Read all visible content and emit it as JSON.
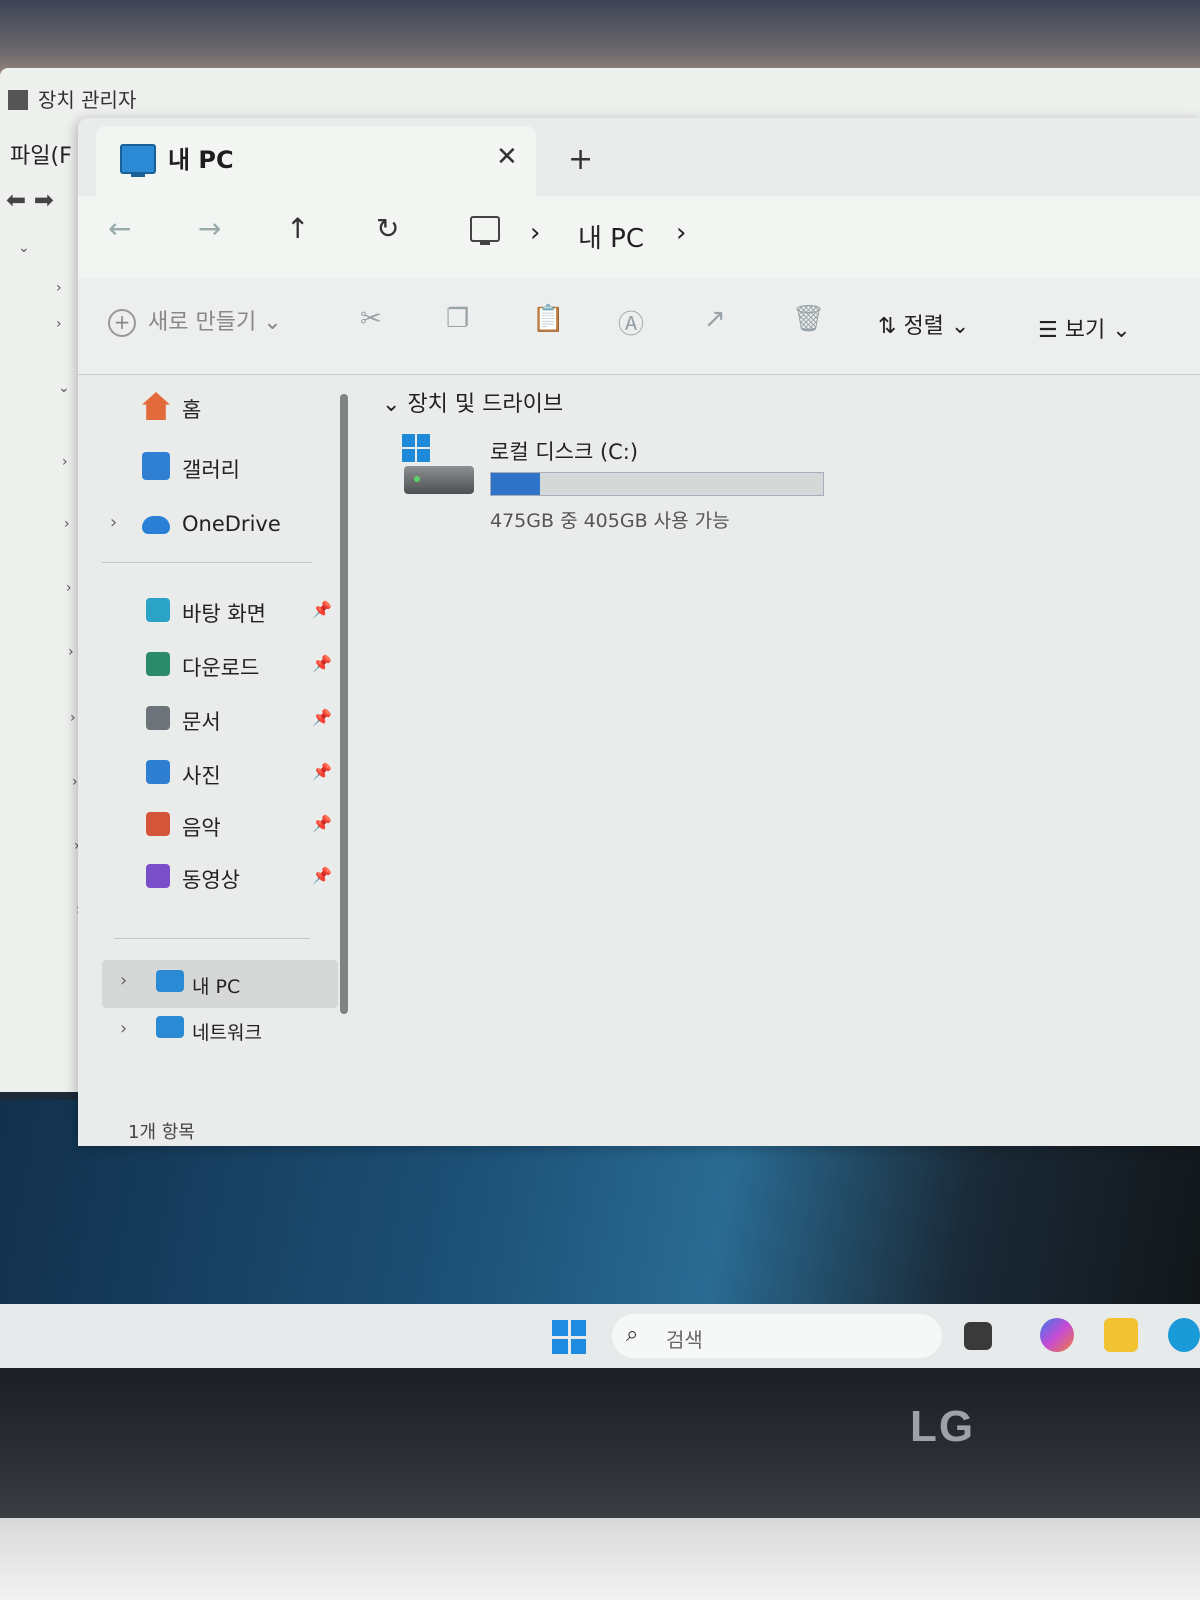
{
  "background_window": {
    "title": "장치 관리자",
    "menu_file": "파일(F"
  },
  "tab": {
    "title": "내 PC",
    "close": "✕",
    "add": "+"
  },
  "nav": {
    "back": "←",
    "forward": "→",
    "up": "↑",
    "refresh": "↻",
    "separator": "›",
    "location": "내 PC"
  },
  "toolbar": {
    "new_label": "새로 만들기",
    "sort_label": "정렬",
    "view_label": "보기",
    "dropdown": "⌄"
  },
  "sidebar": {
    "home": "홈",
    "gallery": "갤러리",
    "onedrive": "OneDrive",
    "quick": [
      {
        "label": "바탕 화면",
        "icon": "desktop-icon",
        "color": "#2aa3c7"
      },
      {
        "label": "다운로드",
        "icon": "download-icon",
        "color": "#2a8a6a"
      },
      {
        "label": "문서",
        "icon": "documents-icon",
        "color": "#6c7379"
      },
      {
        "label": "사진",
        "icon": "pictures-icon",
        "color": "#2e7fd1"
      },
      {
        "label": "음악",
        "icon": "music-icon",
        "color": "#d5553a"
      },
      {
        "label": "동영상",
        "icon": "videos-icon",
        "color": "#7a4ec9"
      }
    ],
    "this_pc": "내 PC",
    "network": "네트워크",
    "pin": "📌",
    "chevron": "›"
  },
  "main": {
    "section_title": "장치 및 드라이브",
    "drive": {
      "name": "로컬 디스크 (C:)",
      "free_text": "475GB 중 405GB 사용 가능",
      "used_fraction": 0.147
    }
  },
  "status": {
    "item_count": "1개 항목"
  },
  "taskbar": {
    "search_placeholder": "검색"
  },
  "brand": "LG"
}
